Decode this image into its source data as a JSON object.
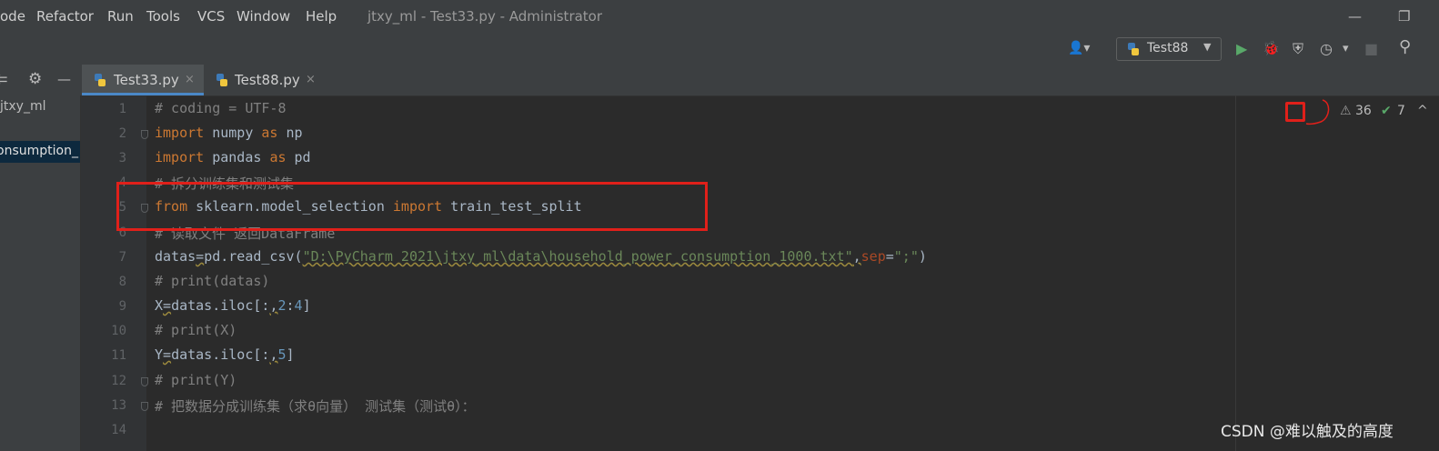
{
  "menubar": {
    "items": [
      "ode",
      "Refactor",
      "Run",
      "Tools",
      "VCS",
      "Window",
      "Help"
    ],
    "window_title": "jtxy_ml - Test33.py - Administrator",
    "minimize": "—",
    "restore": "❐"
  },
  "toolbar": {
    "run_config_label": "Test88",
    "run_config_dropdown": "▼",
    "user_icon": "👤▾",
    "run_icon": "▶",
    "debug_icon": "🐞",
    "coverage_icon": "⛨",
    "profile_icon": "◷",
    "profile_dropdown": "▾",
    "stop_icon": "■",
    "search_icon": "⚲"
  },
  "project_tools": {
    "collapse_icon": "⇇",
    "settings_icon": "⚙",
    "hide_icon": "—"
  },
  "tabs": [
    {
      "label": "Test33.py",
      "close": "×",
      "active": true
    },
    {
      "label": "Test88.py",
      "close": "×",
      "active": false
    }
  ],
  "sidebar": {
    "items": [
      "jtxy_ml",
      "onsumption_"
    ]
  },
  "editor": {
    "line_numbers": [
      "1",
      "2",
      "3",
      "4",
      "5",
      "6",
      "7",
      "8",
      "9",
      "10",
      "11",
      "12",
      "13",
      "14"
    ]
  },
  "inspections": {
    "warnings_icon": "⚠",
    "warnings": "36",
    "weak_icon": "✔",
    "weak": "7",
    "nav_icon": "^"
  },
  "watermark": "CSDN @难以触及的高度",
  "colors": {
    "keyword": "#cc7832",
    "comment": "#808080",
    "string": "#6a8759",
    "number": "#6897bb",
    "annotation": "#e0201a"
  }
}
